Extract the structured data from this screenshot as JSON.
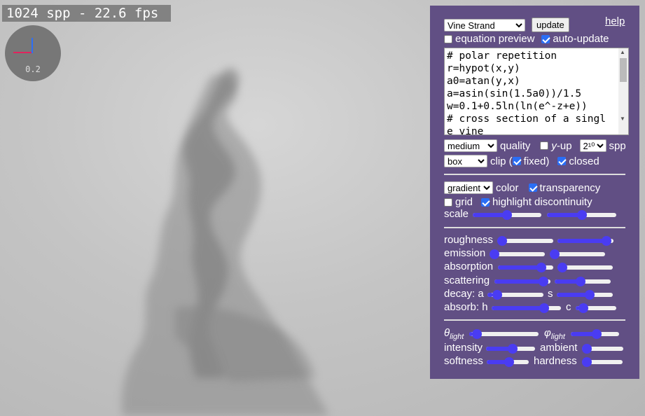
{
  "hud": {
    "fps_text": "1024 spp - 22.6 fps",
    "axes_scale": "0.2"
  },
  "colors": {
    "panel_bg": "#614f84",
    "slider_accent": "#4a3cf2",
    "axis_x": "#e0245e",
    "axis_y": "#2d6ff5"
  },
  "panel": {
    "preset": {
      "selected": "Vine Strand"
    },
    "update_label": "update",
    "help_label": "help",
    "equation_preview": {
      "label": "equation preview",
      "checked": false
    },
    "auto_update": {
      "label": "auto-update",
      "checked": true
    },
    "code": "# polar repetition\nr=hypot(x,y)\na0=atan(y,x)\na=asin(sin(1.5a0))/1.5\nw=0.1+0.5ln(ln(e^-z+e))\n# cross section of a single vine",
    "quality": {
      "selected": "medium",
      "label": "quality"
    },
    "y_up": {
      "label_italic": "y",
      "label_rest": "-up",
      "checked": false
    },
    "spp": {
      "selected": "2¹⁰",
      "label": "spp"
    },
    "clip": {
      "selected": "box",
      "label": "clip (",
      "close": ")"
    },
    "fixed": {
      "label": "fixed",
      "checked": true
    },
    "closed": {
      "label": "closed",
      "checked": true
    },
    "color": {
      "selected": "gradient",
      "label": "color"
    },
    "transparency": {
      "label": "transparency",
      "checked": true
    },
    "grid": {
      "label": "grid",
      "checked": false
    },
    "highlight_discontinuity": {
      "label": "highlight discontinuity",
      "checked": true
    },
    "scale": {
      "label": "scale",
      "values": [
        0.5,
        0.5
      ]
    },
    "roughness": {
      "label": "roughness",
      "values": [
        0.0,
        0.95
      ]
    },
    "emission": {
      "label": "emission",
      "values": [
        0.0,
        0.0
      ]
    },
    "absorption": {
      "label": "absorption",
      "values": [
        0.85,
        0.0
      ]
    },
    "scattering": {
      "label": "scattering",
      "values": [
        0.95,
        0.45
      ]
    },
    "decay": {
      "label": "decay: a",
      "label2": "s",
      "values": [
        0.1,
        0.6
      ]
    },
    "absorb": {
      "label": "absorb: h",
      "label2": "c",
      "values": [
        0.8,
        0.1
      ]
    },
    "theta_light": {
      "symbol": "θ",
      "sub": "light",
      "value": 0.05
    },
    "phi_light": {
      "symbol": "φ",
      "sub": "light",
      "value": 0.55
    },
    "intensity": {
      "label": "intensity",
      "value": 0.55
    },
    "ambient": {
      "label": "ambient",
      "value": 0.0
    },
    "softness": {
      "label": "softness",
      "value": 0.55
    },
    "hardness": {
      "label": "hardness",
      "value": 0.0
    }
  }
}
